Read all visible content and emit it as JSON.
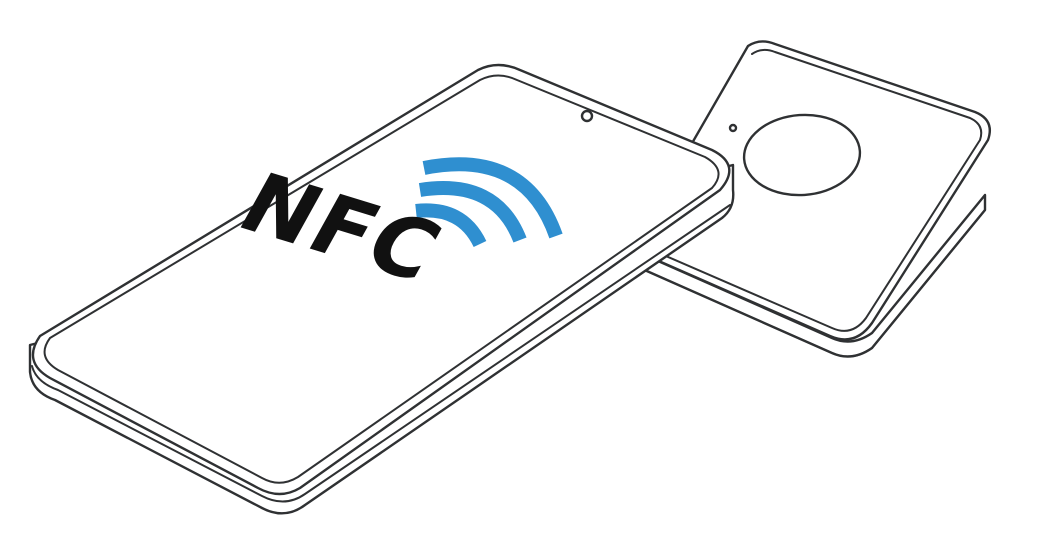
{
  "illustration": {
    "logo_text": "NFC",
    "colors": {
      "outline": "#2f3133",
      "logo_text": "#111111",
      "wave": "#2f8fd0",
      "background": "#ffffff"
    }
  }
}
